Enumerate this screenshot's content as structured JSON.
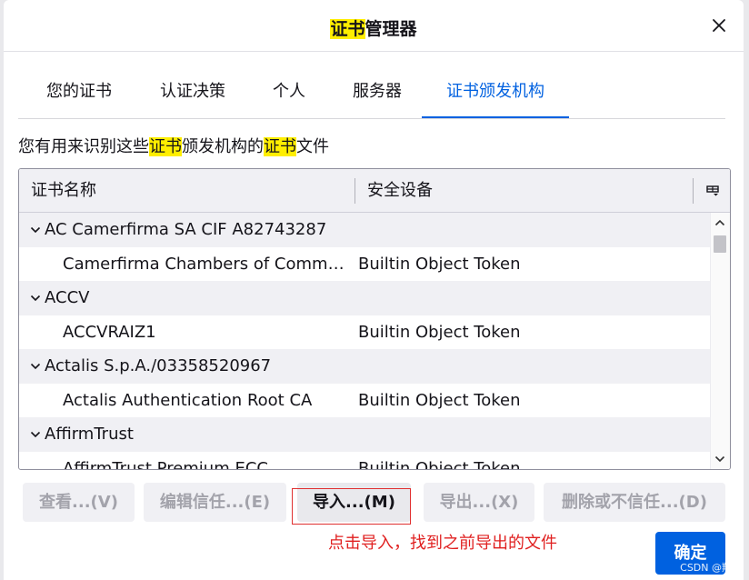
{
  "dialog": {
    "title_hl1": "证书",
    "title_rest": "管理器"
  },
  "tabs": [
    {
      "label": "您的证书"
    },
    {
      "label": "认证决策"
    },
    {
      "label": "个人"
    },
    {
      "label": "服务器"
    },
    {
      "label": "证书颁发机构",
      "active": true
    }
  ],
  "description": {
    "p1": "您有用来识别这些",
    "hl1": "证书",
    "p2": "颁发机构的",
    "hl2": "证书",
    "p3": "文件"
  },
  "table": {
    "columns": [
      "证书名称",
      "安全设备"
    ],
    "rows": [
      {
        "type": "group",
        "name": "AC Camerfirma SA CIF A82743287"
      },
      {
        "type": "cert",
        "name": "Camerfirma Chambers of Commerce Root",
        "token": "Builtin Object Token"
      },
      {
        "type": "group",
        "name": "ACCV"
      },
      {
        "type": "cert",
        "name": "ACCVRAIZ1",
        "token": "Builtin Object Token"
      },
      {
        "type": "group",
        "name": "Actalis S.p.A./03358520967"
      },
      {
        "type": "cert",
        "name": "Actalis Authentication Root CA",
        "token": "Builtin Object Token"
      },
      {
        "type": "group",
        "name": "AffirmTrust"
      },
      {
        "type": "cert",
        "name": "AffirmTrust Premium ECC",
        "token": "Builtin Object Token"
      }
    ]
  },
  "buttons": {
    "view": "查看...(V)",
    "edit_trust": "编辑信任...(E)",
    "import": "导入...(M)",
    "export": "导出...(X)",
    "delete": "删除或不信任...(D)",
    "ok": "确定"
  },
  "annotation": "点击导入，找到之前导出的文件",
  "watermark": "CSDN @翔域",
  "colors": {
    "accent": "#0061e0",
    "highlight": "#ffee00",
    "annotation": "#e02020"
  }
}
